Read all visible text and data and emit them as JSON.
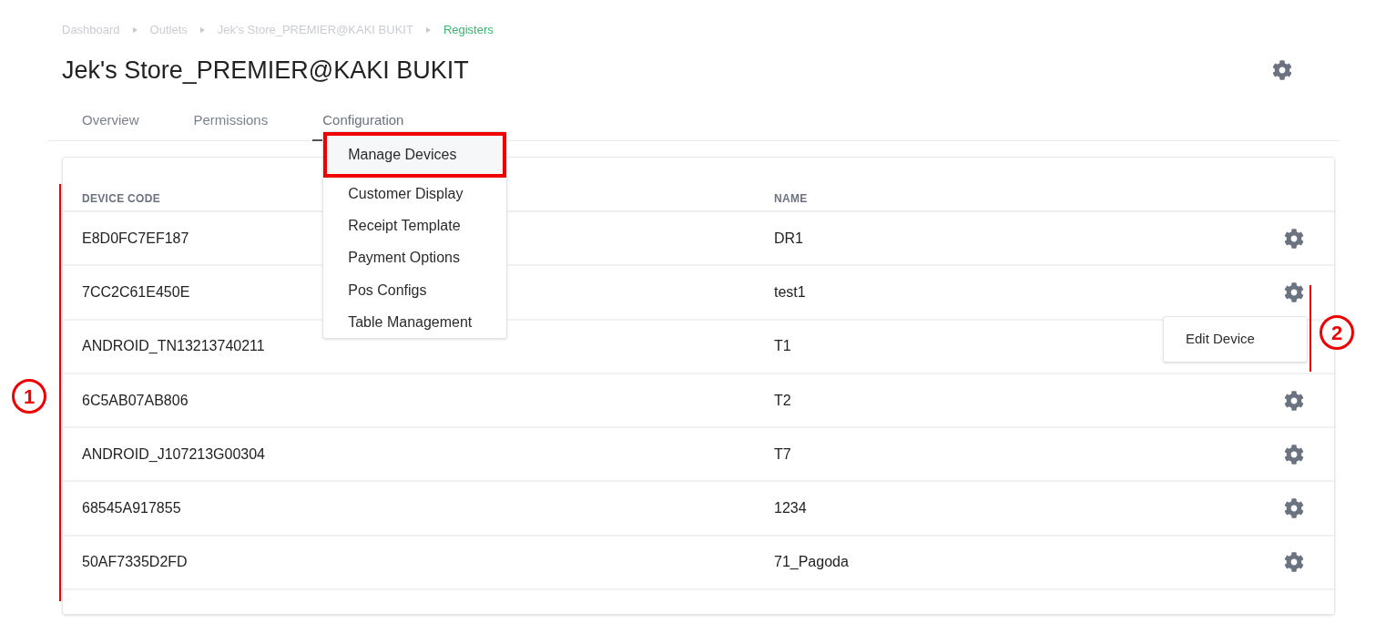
{
  "breadcrumb": [
    {
      "label": "Dashboard",
      "current": false
    },
    {
      "label": "Outlets",
      "current": false
    },
    {
      "label": "Jek's Store_PREMIER@KAKI BUKIT",
      "current": false
    },
    {
      "label": "Registers",
      "current": true
    }
  ],
  "title": "Jek's Store_PREMIER@KAKI BUKIT",
  "tabs": [
    {
      "label": "Overview",
      "selected": false
    },
    {
      "label": "Permissions",
      "selected": false
    },
    {
      "label": "Configuration",
      "selected": true,
      "expanded": true
    }
  ],
  "configuration_menu": [
    {
      "label": "Manage Devices",
      "highlighted": true
    },
    {
      "label": "Customer Display",
      "highlighted": false
    },
    {
      "label": "Receipt Template",
      "highlighted": false
    },
    {
      "label": "Payment Options",
      "highlighted": false
    },
    {
      "label": "Pos Configs",
      "highlighted": false
    },
    {
      "label": "Table Management",
      "highlighted": false
    }
  ],
  "table": {
    "columns": [
      "DEVICE CODE",
      "NAME"
    ],
    "rows": [
      {
        "device_code": "E8D0FC7EF187",
        "name": "DR1"
      },
      {
        "device_code": "7CC2C61E450E",
        "name": "test1"
      },
      {
        "device_code": "ANDROID_TN13213740211",
        "name": "T1"
      },
      {
        "device_code": "6C5AB07AB806",
        "name": "T2"
      },
      {
        "device_code": "ANDROID_J107213G00304",
        "name": "T7"
      },
      {
        "device_code": "68545A917855",
        "name": "1234"
      },
      {
        "device_code": "50AF7335D2FD",
        "name": "71_Pagoda"
      }
    ],
    "row_menu": [
      "Edit Device"
    ]
  },
  "annotations": [
    {
      "label": "1"
    },
    {
      "label": "2"
    }
  ]
}
